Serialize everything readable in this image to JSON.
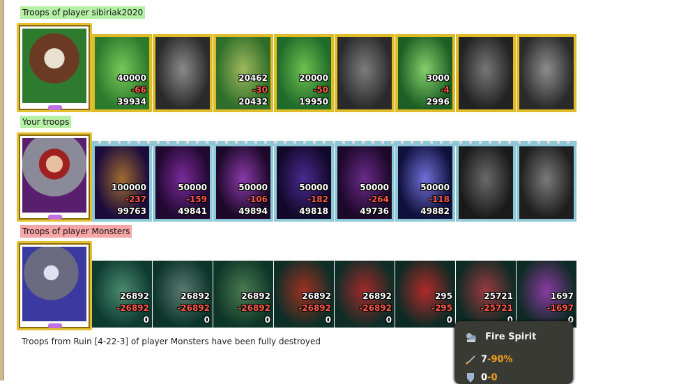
{
  "sections": [
    {
      "title": "Troops of player sibiriak2020",
      "title_color": "#b6f0a6",
      "frame": "gold",
      "hero_icon": "horned-skull-warrior",
      "units": [
        {
          "icon": "dwarf-archer",
          "count": "40000",
          "loss": "-66",
          "remaining": "39934",
          "art": [
            "#2c7a2c",
            "#79c85a"
          ]
        },
        {
          "icon": "gray-knight",
          "count": "",
          "loss": "",
          "remaining": "",
          "art": [
            "#2a2a2a",
            "#8a8a8a"
          ]
        },
        {
          "icon": "elf-spearman",
          "count": "20462",
          "loss": "-30",
          "remaining": "20432",
          "art": [
            "#2f6e2a",
            "#9fb85c"
          ]
        },
        {
          "icon": "green-griffin",
          "count": "20000",
          "loss": "-50",
          "remaining": "19950",
          "art": [
            "#1f6b2a",
            "#6ec050"
          ]
        },
        {
          "icon": "gray-archer",
          "count": "",
          "loss": "",
          "remaining": "",
          "art": [
            "#2a2a2a",
            "#7d7d7d"
          ]
        },
        {
          "icon": "dryad",
          "count": "3000",
          "loss": "-4",
          "remaining": "2996",
          "art": [
            "#1c5e24",
            "#84d06a"
          ]
        },
        {
          "icon": "gray-armored-warrior",
          "count": "",
          "loss": "",
          "remaining": "",
          "art": [
            "#222",
            "#777"
          ]
        },
        {
          "icon": "gray-mage",
          "count": "",
          "loss": "",
          "remaining": "",
          "art": [
            "#2a2a2a",
            "#8d8d8d"
          ]
        }
      ]
    },
    {
      "title": "Your troops",
      "title_color": "#b6f0a6",
      "frame": "purple",
      "hero_icon": "red-haired-knight",
      "units": [
        {
          "icon": "mushroom-beast",
          "count": "100000",
          "loss": "-237",
          "remaining": "99763",
          "art": [
            "#1c0c3c",
            "#a06a30"
          ]
        },
        {
          "icon": "skeleton-warrior",
          "count": "50000",
          "loss": "-159",
          "remaining": "49841",
          "art": [
            "#200830",
            "#7a2a9a"
          ]
        },
        {
          "icon": "bone-dragon",
          "count": "50000",
          "loss": "-106",
          "remaining": "49894",
          "art": [
            "#1c0828",
            "#8a3aa8"
          ]
        },
        {
          "icon": "shadow-dragon",
          "count": "50000",
          "loss": "-182",
          "remaining": "49818",
          "art": [
            "#12082a",
            "#4a2a90"
          ]
        },
        {
          "icon": "death-knight",
          "count": "50000",
          "loss": "-264",
          "remaining": "49736",
          "art": [
            "#1c0828",
            "#6a2a8a"
          ]
        },
        {
          "icon": "banshee",
          "count": "50000",
          "loss": "-118",
          "remaining": "49882",
          "art": [
            "#10103c",
            "#7070d8"
          ]
        },
        {
          "icon": "gray-reaper",
          "count": "",
          "loss": "",
          "remaining": "",
          "art": [
            "#1a1a1a",
            "#6a6a6a"
          ]
        },
        {
          "icon": "gray-lich",
          "count": "",
          "loss": "",
          "remaining": "",
          "art": [
            "#1e1e1e",
            "#7a7a7a"
          ]
        }
      ]
    },
    {
      "title": "Troops of player Monsters",
      "title_color": "#f6a6a6",
      "frame": "plain",
      "hero_icon": "beast-lord",
      "units": [
        {
          "icon": "lizard-archer",
          "count": "26892",
          "loss": "-26892",
          "remaining": "0",
          "art": [
            "#0e3a30",
            "#4a8a70"
          ]
        },
        {
          "icon": "armored-ogre",
          "count": "26892",
          "loss": "-26892",
          "remaining": "0",
          "art": [
            "#0c3428",
            "#5a7a70"
          ]
        },
        {
          "icon": "orc-shaman",
          "count": "26892",
          "loss": "-26892",
          "remaining": "0",
          "art": [
            "#0e3628",
            "#4a7a50"
          ]
        },
        {
          "icon": "red-demon",
          "count": "26892",
          "loss": "-26892",
          "remaining": "0",
          "art": [
            "#0e2e28",
            "#a03020"
          ]
        },
        {
          "icon": "fire-spirit",
          "count": "26892",
          "loss": "-26892",
          "remaining": "0",
          "art": [
            "#102c26",
            "#a02a2a"
          ]
        },
        {
          "icon": "red-dragon",
          "count": "295",
          "loss": "-295",
          "remaining": "0",
          "art": [
            "#0e2a24",
            "#b02a2a"
          ]
        },
        {
          "icon": "crystal-golem",
          "count": "25721",
          "loss": "-25721",
          "remaining": "0",
          "art": [
            "#0e2a24",
            "#9a3a40"
          ]
        },
        {
          "icon": "pit-lord",
          "count": "1697",
          "loss": "-1697",
          "remaining": "0",
          "art": [
            "#0e2a24",
            "#8a3aa0"
          ]
        }
      ]
    }
  ],
  "status_message": "Troops from Ruin [4-22-3] of player Monsters have been fully destroyed",
  "tooltip": {
    "title": "Fire Spirit",
    "icon": "creature-stack-icon",
    "attack": {
      "icon": "sword-icon",
      "base": "7",
      "modifier": "-90%"
    },
    "defense": {
      "icon": "shield-icon",
      "base": "0",
      "modifier": "-0"
    }
  }
}
